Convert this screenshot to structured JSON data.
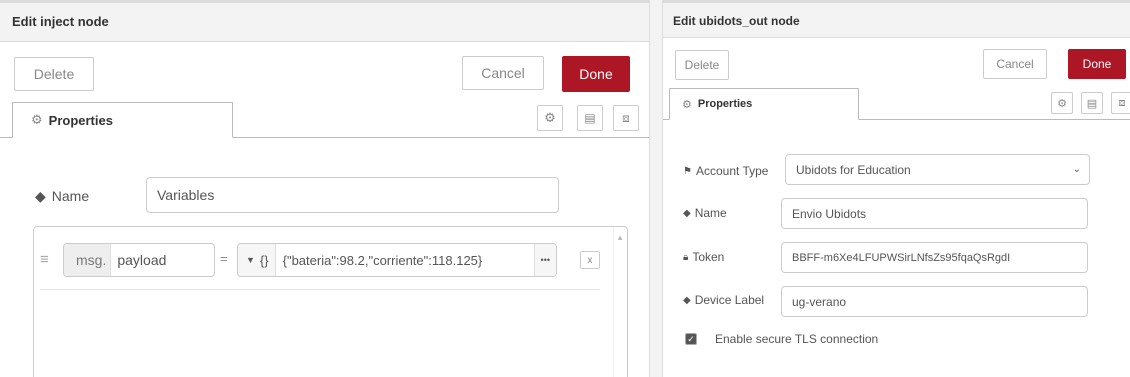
{
  "inject": {
    "title": "Edit inject node",
    "delete_label": "Delete",
    "cancel_label": "Cancel",
    "done_label": "Done",
    "tab_label": "Properties",
    "name_label": "Name",
    "name_value": "Variables",
    "row": {
      "prefix": "msg.",
      "property": "payload",
      "equals": "=",
      "type_label": "{}",
      "value": "{\"bateria\":98.2,\"corriente\":118.125}",
      "ellipsis": "•••",
      "remove": "x"
    }
  },
  "ubidots": {
    "title": "Edit ubidots_out node",
    "delete_label": "Delete",
    "cancel_label": "Cancel",
    "done_label": "Done",
    "tab_label": "Properties",
    "account_type_label": "Account Type",
    "account_type_value": "Ubidots for Education",
    "name_label": "Name",
    "name_value": "Envio Ubidots",
    "token_label": "Token",
    "token_value": "BBFF-m6Xe4LFUPWSirLNfsZs95fqaQsRgdI",
    "device_label_label": "Device Label",
    "device_label_value": "ug-verano",
    "tls_label": "Enable secure TLS connection",
    "tls_checked": true
  },
  "colors": {
    "primary": "#ad1625",
    "header_bg": "#f3f3f3",
    "border": "#cccccc"
  }
}
